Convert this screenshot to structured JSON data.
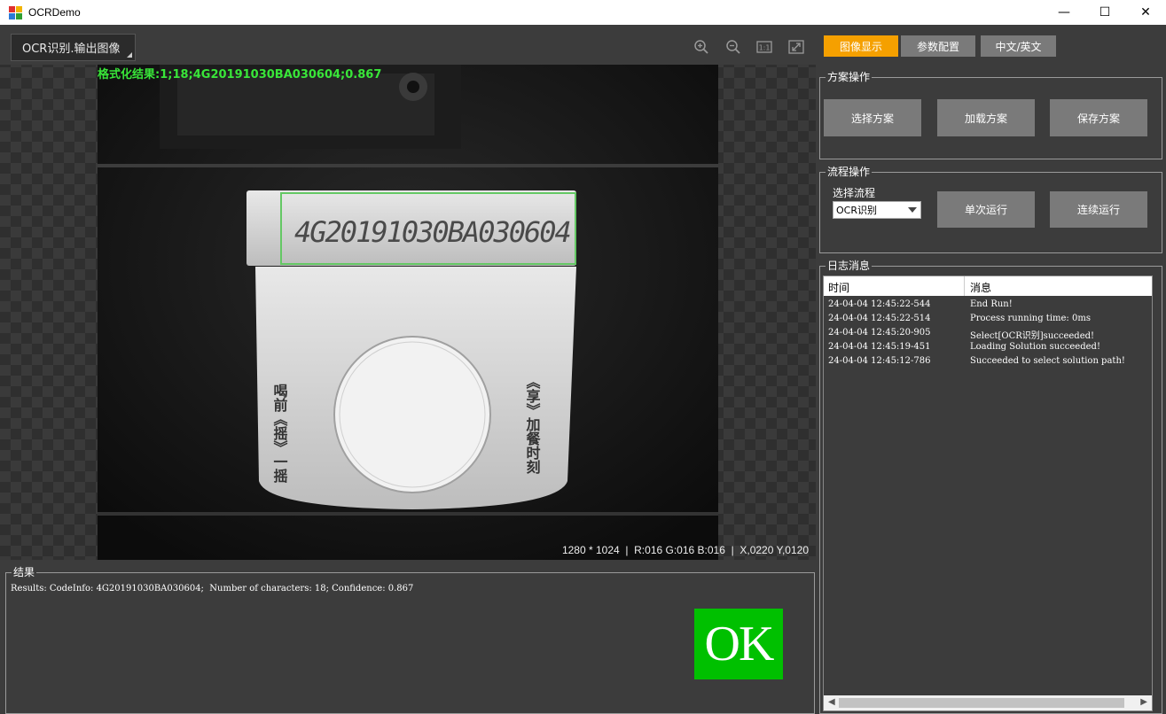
{
  "window": {
    "title": "OCRDemo",
    "minimize_glyph": "—",
    "maximize_glyph": "☐",
    "close_glyph": "✕"
  },
  "image_panel": {
    "source_label": "OCR识别.输出图像",
    "overlay_result": "格式化结果:1;18;4G20191030BA030604;0.867",
    "ocr_code_on_image": "4G20191030BA030604",
    "left_side_text": "喝前《摇》一摇",
    "right_side_text": "《享》加餐时刻",
    "status": {
      "resolution": "1280 * 1024",
      "rgb": "R:016  G:016  B:016",
      "coords": "X,0220  Y,0120"
    },
    "tools": [
      "zoom-in-icon",
      "zoom-out-icon",
      "actual-size-icon",
      "fit-window-icon"
    ]
  },
  "result": {
    "group_label": "结果",
    "text": "Results: CodeInfo: 4G20191030BA030604;  Number of characters: 18; Confidence: 0.867",
    "badge": "OK",
    "badge_color": "#00c000"
  },
  "right_panel": {
    "tabs": [
      {
        "label": "图像显示",
        "active": true
      },
      {
        "label": "参数配置",
        "active": false
      },
      {
        "label": "中文/英文",
        "active": false
      }
    ],
    "accent": "#f5a000",
    "scheme_group": {
      "label": "方案操作",
      "buttons": [
        "选择方案",
        "加载方案",
        "保存方案"
      ]
    },
    "flow_group": {
      "label": "流程操作",
      "select_label": "选择流程",
      "select_value": "OCR识别",
      "buttons": [
        "单次运行",
        "连续运行"
      ]
    },
    "log_group": {
      "label": "日志消息",
      "columns": [
        "时间",
        "消息"
      ],
      "rows": [
        {
          "time": "24-04-04 12:45:22-544",
          "msg": "End Run!"
        },
        {
          "time": "24-04-04 12:45:22-514",
          "msg": "Process running time: 0ms"
        },
        {
          "time": "24-04-04 12:45:20-905",
          "msg": "Select[OCR识别]succeeded!"
        },
        {
          "time": "24-04-04 12:45:19-451",
          "msg": "Loading Solution succeeded!"
        },
        {
          "time": "24-04-04 12:45:12-786",
          "msg": "Succeeded to select solution path!"
        }
      ]
    }
  }
}
